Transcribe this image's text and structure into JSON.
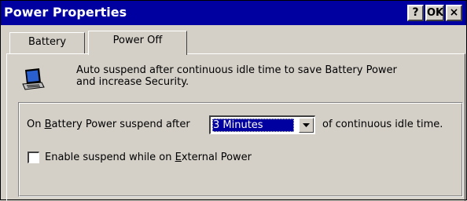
{
  "window": {
    "title": "Power Properties"
  },
  "titlebar_buttons": {
    "help": "?",
    "ok": "OK",
    "close": "×"
  },
  "tabs": [
    {
      "label": "Battery",
      "active": false
    },
    {
      "label": "Power Off",
      "active": true
    }
  ],
  "description": {
    "icon": "laptop-icon",
    "line1": "Auto suspend after continuous idle time to save Battery Power",
    "line2": "and increase Security."
  },
  "suspend": {
    "prefix_before_accel": "On ",
    "accel": "B",
    "prefix_after_accel": "attery Power suspend after",
    "selected_value": "3 Minutes",
    "suffix": "of continuous idle time."
  },
  "external_power": {
    "label_before_accel": "Enable suspend while on ",
    "accel": "E",
    "label_after_accel": "xternal Power",
    "checked": false
  },
  "colors": {
    "titlebar": "#0000a0",
    "face": "#d4d0c8",
    "selection": "#0000a0"
  }
}
